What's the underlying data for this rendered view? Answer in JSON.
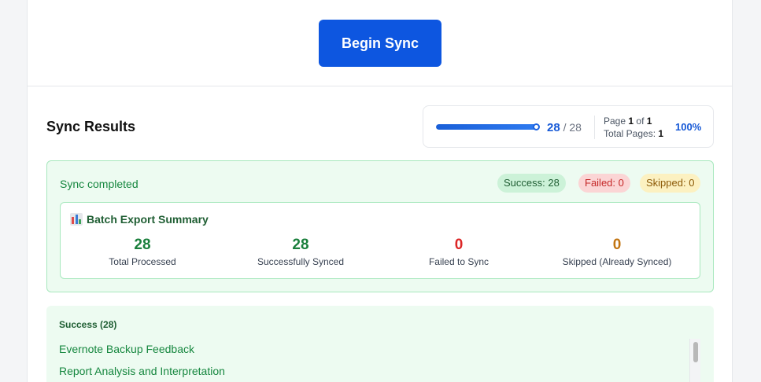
{
  "top": {
    "sync_button": "Begin Sync"
  },
  "results": {
    "title": "Sync Results",
    "progress": {
      "current": "28",
      "total_text": "/ 28",
      "fraction": 1.0,
      "page_label": "Page",
      "page_current": "1",
      "page_of": "of",
      "page_total": "1",
      "total_pages_label": "Total Pages:",
      "total_pages": "1",
      "percent": "100%"
    },
    "status": {
      "text": "Sync completed",
      "badges": {
        "success": "Success: 28",
        "failed": "Failed: 0",
        "skipped": "Skipped: 0"
      }
    },
    "summary": {
      "title": "Batch Export Summary",
      "stats": [
        {
          "value": "28",
          "label": "Total Processed",
          "color": "#1a7f3c"
        },
        {
          "value": "28",
          "label": "Successfully Synced",
          "color": "#1a7f3c"
        },
        {
          "value": "0",
          "label": "Failed to Sync",
          "color": "#dc2626"
        },
        {
          "value": "0",
          "label": "Skipped (Already Synced)",
          "color": "#c27411"
        }
      ]
    },
    "success_list": {
      "header": "Success (28)",
      "items": [
        "Evernote Backup Feedback",
        "Report Analysis and Interpretation"
      ]
    }
  },
  "icons": {
    "summary_icon": "bar-chart-icon"
  },
  "colors": {
    "accent": "#0d56e0",
    "success": "#16873f",
    "failed": "#dc2626",
    "skipped": "#c27411"
  }
}
